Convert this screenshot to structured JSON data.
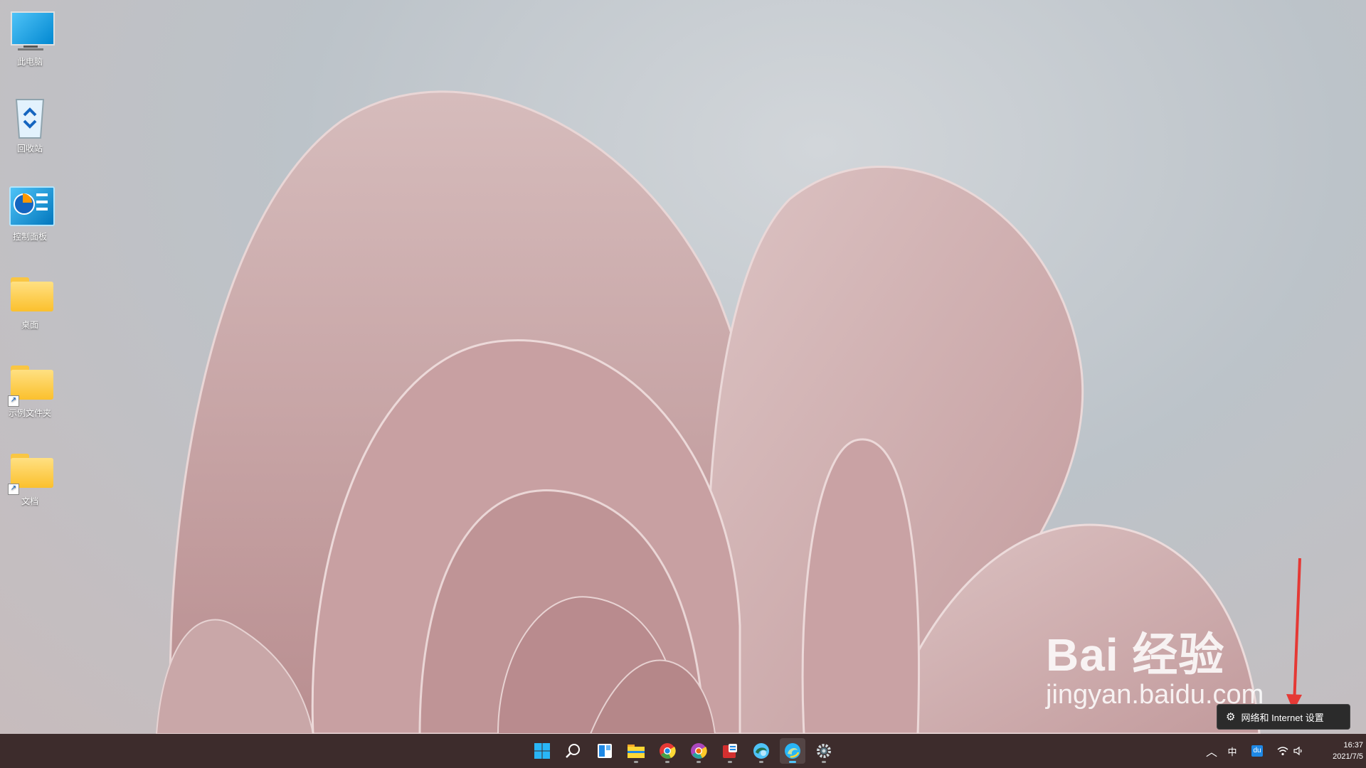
{
  "desktop": {
    "icons": [
      {
        "label": "此电脑",
        "icon": "computer-icon"
      },
      {
        "label": "回收站",
        "icon": "recycle-bin-icon"
      },
      {
        "label": "控制面板",
        "icon": "control-panel-icon"
      },
      {
        "label": "桌面",
        "icon": "folder-icon"
      },
      {
        "label": "示例文件夹",
        "icon": "folder-shortcut-icon"
      },
      {
        "label": "文档",
        "icon": "folder-shortcut-icon"
      }
    ]
  },
  "taskbar": {
    "apps": [
      "start",
      "search",
      "widgets",
      "file-explorer",
      "chrome",
      "chrome-canary",
      "wps",
      "edge-beta",
      "edge",
      "settings"
    ],
    "tray": {
      "ime": "中",
      "app_badge": "du",
      "time": "16:37",
      "date": "2021/7/5"
    }
  },
  "tooltip": {
    "text": "网络和 Internet 设置",
    "icon": "gear-icon"
  },
  "watermark": {
    "logo": "Bai 经验",
    "url": "jingyan.baidu.com"
  },
  "colors": {
    "taskbar": "#3d2c2c",
    "accent": "#0078d4",
    "arrow": "#e53935"
  }
}
